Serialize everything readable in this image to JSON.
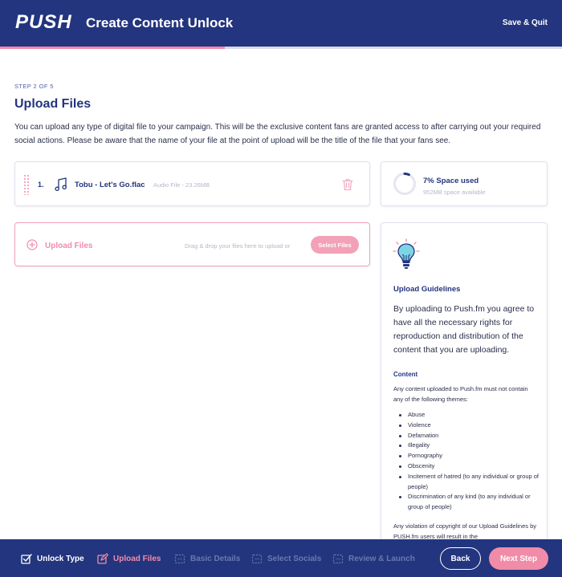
{
  "header": {
    "logo": "PUSH",
    "title": "Create Content Unlock",
    "save_quit": "Save & Quit",
    "progress": 0.4
  },
  "main": {
    "step_label": "STEP 2 OF 5",
    "title": "Upload Files",
    "intro": "You can upload any type of digital file to your campaign. This will be the exclusive content fans are granted access to after carrying out your required social actions. Please be aware that the name of your file at the point of upload will be the title of the file that your fans see."
  },
  "files": [
    {
      "number": "1.",
      "name": "Tobu - Let's Go.flac",
      "meta": "Audio File - 23.26MB",
      "icon": "music-note-icon"
    }
  ],
  "storage": {
    "title": "7% Space used",
    "available": "952MB space available",
    "percent_used": 7
  },
  "upload": {
    "label": "Upload Files",
    "drag_text": "Drag & drop your files here to upload or",
    "select_button": "Select Files"
  },
  "guidelines": {
    "title": "Upload Guidelines",
    "lead": "By uploading to Push.fm you agree to have all the necessary rights for reproduction and distribution of the content that you are uploading.",
    "content_heading": "Content",
    "content_text": "Any content uploaded to Push.fm must not contain any of the following themes:",
    "themes": [
      "Abuse",
      "Violence",
      "Defamation",
      "Illegality",
      "Pornography",
      "Obscenity",
      "Incitement of hatred (to any individual or group of people)",
      "Discrimination of any kind (to any individual or group of people)"
    ],
    "violation_text": "Any violation of copyright of our Upload Guidelines by PUSH.fm users will result in the"
  },
  "footer": {
    "steps": [
      {
        "label": "Unlock Type",
        "state": "done"
      },
      {
        "label": "Upload Files",
        "state": "active"
      },
      {
        "label": "Basic Details",
        "state": "pending"
      },
      {
        "label": "Select Socials",
        "state": "pending"
      },
      {
        "label": "Review & Launch",
        "state": "pending"
      }
    ],
    "back": "Back",
    "next": "Next Step"
  },
  "colors": {
    "navy": "#23357e",
    "pink": "#f08ca8",
    "muted": "#6c78ad"
  }
}
